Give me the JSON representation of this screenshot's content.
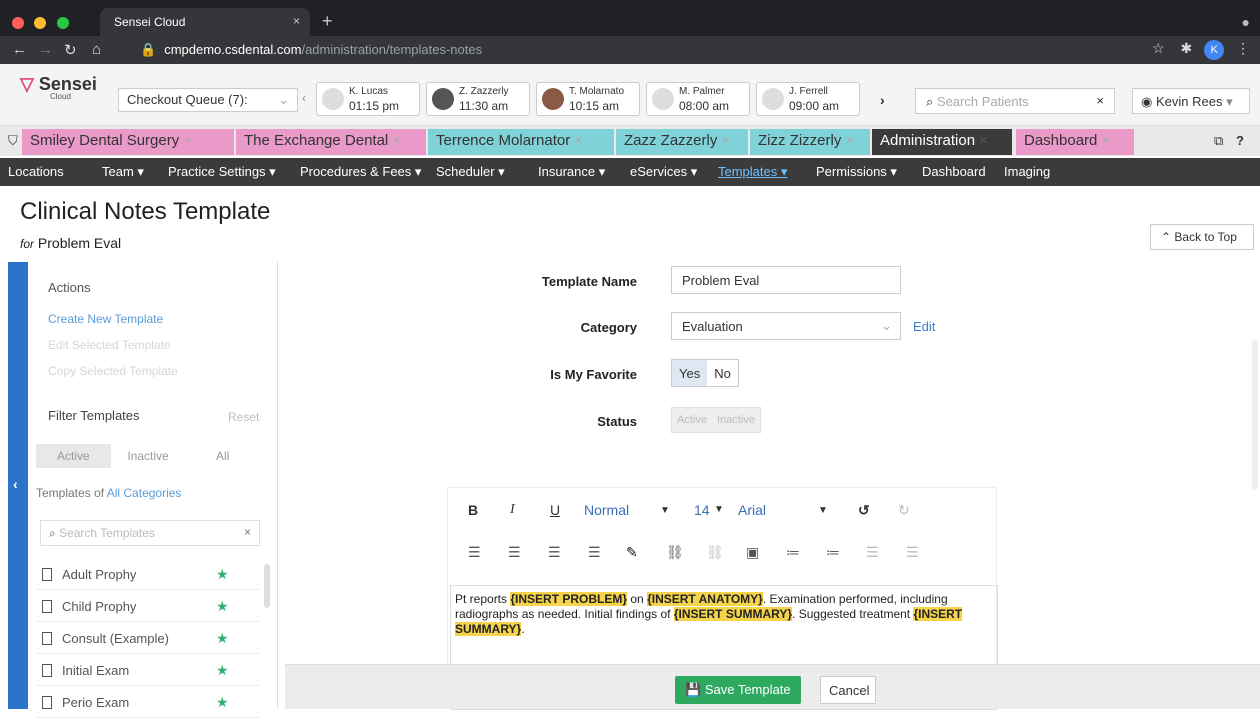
{
  "browser": {
    "tab_title": "Sensei Cloud",
    "url_host": "cmpdemo.csdental.com",
    "url_path": "/administration/templates-notes",
    "profile_letter": "K"
  },
  "appbar": {
    "logo_text": "Sensei",
    "logo_sub": "Cloud",
    "queue_label": "Checkout Queue (7):",
    "appointments": [
      {
        "name": "K. Lucas",
        "time": "01:15 pm"
      },
      {
        "name": "Z. Zazzerly",
        "time": "11:30 am"
      },
      {
        "name": "T. Molarnato",
        "time": "10:15 am"
      },
      {
        "name": "M. Palmer",
        "time": "08:00 am"
      },
      {
        "name": "J. Ferrell",
        "time": "09:00 am"
      }
    ],
    "search_placeholder": "Search Patients",
    "user_name": "Kevin Rees"
  },
  "patient_tabs": [
    {
      "label": "Smiley Dental Surgery",
      "color": "#e99ac9"
    },
    {
      "label": "The Exchange Dental",
      "color": "#e99ac9"
    },
    {
      "label": "Terrence Molarnator",
      "color": "#7fd3d8"
    },
    {
      "label": "Zazz Zazzerly",
      "color": "#7fd3d8"
    },
    {
      "label": "Zizz Zizzerly",
      "color": "#7fd3d8"
    },
    {
      "label": "Administration",
      "color": "#3b3b3b"
    },
    {
      "label": "Dashboard",
      "color": "#e99ac9"
    }
  ],
  "menu": [
    "Locations",
    "Team ▾",
    "Practice Settings ▾",
    "Procedures & Fees ▾",
    "Scheduler ▾",
    "Insurance ▾",
    "eServices ▾",
    "Templates ▾",
    "Permissions ▾",
    "Dashboard",
    "Imaging"
  ],
  "page": {
    "title": "Clinical Notes Template",
    "for_label": "for",
    "subtitle": "Problem Eval",
    "back_to_top": "Back to Top"
  },
  "sidebar": {
    "actions": "Actions",
    "create": "Create New Template",
    "edit_selected": "Edit Selected Template",
    "copy_selected": "Copy Selected Template",
    "filter": "Filter Templates",
    "reset": "Reset",
    "seg": [
      "Active",
      "Inactive",
      "All"
    ],
    "templates_of": "Templates of",
    "all_categories": "All Categories",
    "search_placeholder": "Search Templates",
    "templates": [
      "Adult Prophy",
      "Child Prophy",
      "Consult (Example)",
      "Initial Exam",
      "Perio Exam"
    ]
  },
  "form": {
    "template_name_label": "Template Name",
    "template_name_value": "Problem Eval",
    "category_label": "Category",
    "category_value": "Evaluation",
    "edit_link": "Edit",
    "favorite_label": "Is My Favorite",
    "yes": "Yes",
    "no": "No",
    "status_label": "Status",
    "active": "Active",
    "inactive": "Inactive"
  },
  "editor": {
    "format": "Normal",
    "size": "14",
    "font": "Arial",
    "t1": "Pt reports ",
    "h1": "{INSERT PROBLEM}",
    "t2": " on ",
    "h2": "{INSERT ANATOMY}",
    "t3": ". Examination performed, including radiographs as needed. Initial findings of ",
    "h3": "{INSERT SUMMARY}",
    "t4": ". Suggested treatment ",
    "h4": "{INSERT SUMMARY}",
    "t5": "."
  },
  "footer": {
    "save": "Save Template",
    "cancel": "Cancel"
  }
}
